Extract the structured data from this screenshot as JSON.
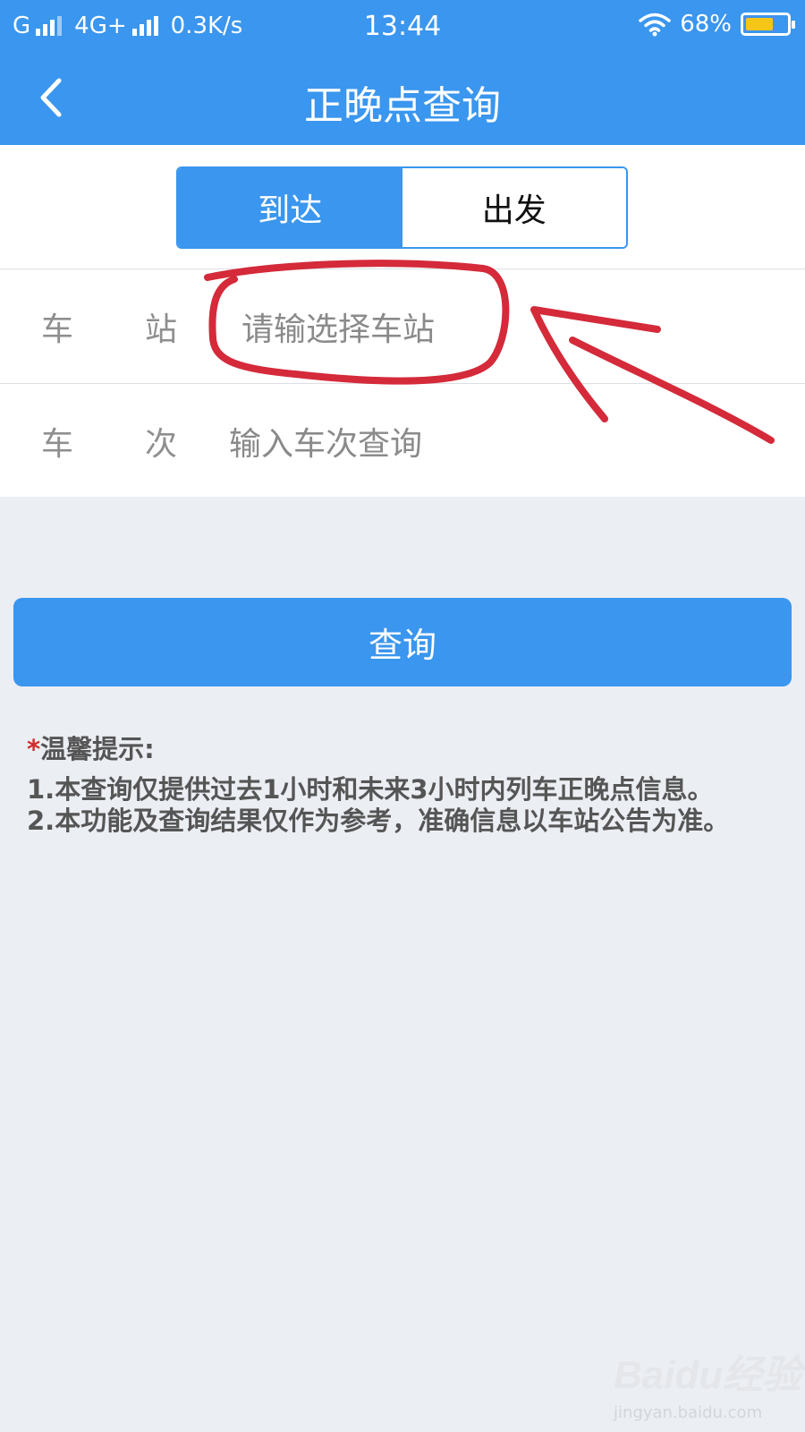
{
  "status_bar": {
    "carrier1": "G",
    "carrier2": "4G+",
    "speed": "0.3K/s",
    "time": "13:44",
    "battery": "68%",
    "battery_level": 0.68,
    "icons": [
      "signal-icon",
      "wifi-icon",
      "battery-icon"
    ]
  },
  "header": {
    "title": "正晚点查询",
    "back_icon": "chevron-left-icon"
  },
  "tabs": [
    {
      "label": "到达",
      "active": true
    },
    {
      "label": "出发",
      "active": false
    }
  ],
  "form": {
    "station": {
      "label_1": "车",
      "label_2": "站",
      "placeholder": "请输选择车站"
    },
    "train": {
      "label_1": "车",
      "label_2": "次",
      "placeholder": "输入车次查询"
    }
  },
  "query_button": "查询",
  "tips": {
    "star": "*",
    "title": "温馨提示:",
    "line1": "1.本查询仅提供过去1小时和未来3小时内列车正晚点信息。",
    "line2": "2.本功能及查询结果仅作为参考，准确信息以车站公告为准。"
  },
  "watermark": {
    "logo": "Baidu经验",
    "url": "jingyan.baidu.com"
  },
  "colors": {
    "primary": "#3a96ee",
    "background": "#ebeef3",
    "annotation": "#d42a3a"
  }
}
